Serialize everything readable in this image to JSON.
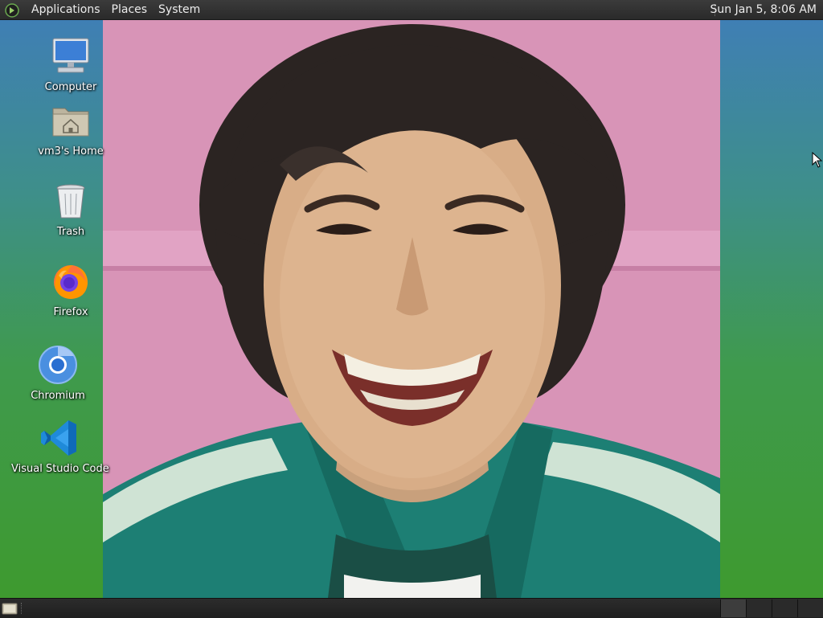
{
  "top_panel": {
    "menus": [
      "Applications",
      "Places",
      "System"
    ],
    "clock": "Sun Jan  5,  8:06 AM"
  },
  "desktop_icons": [
    {
      "label": "Computer",
      "icon": "computer-icon"
    },
    {
      "label": "vm3's Home",
      "icon": "home-folder-icon"
    },
    {
      "label": "Trash",
      "icon": "trash-icon"
    },
    {
      "label": "Firefox",
      "icon": "firefox-icon"
    },
    {
      "label": "Chromium",
      "icon": "chromium-icon"
    },
    {
      "label": "Visual Studio Code",
      "icon": "vscode-icon"
    }
  ],
  "colors": {
    "panel": "#2e2e2e",
    "wall_top": "#3f7fb4",
    "wall_bottom": "#3e9a2f",
    "photo_background": "#d894b7",
    "jacket": "#1d7f74"
  },
  "wallpaper": {
    "icon": "portrait-photo"
  },
  "bottom_panel": {
    "workspaces": 4
  }
}
